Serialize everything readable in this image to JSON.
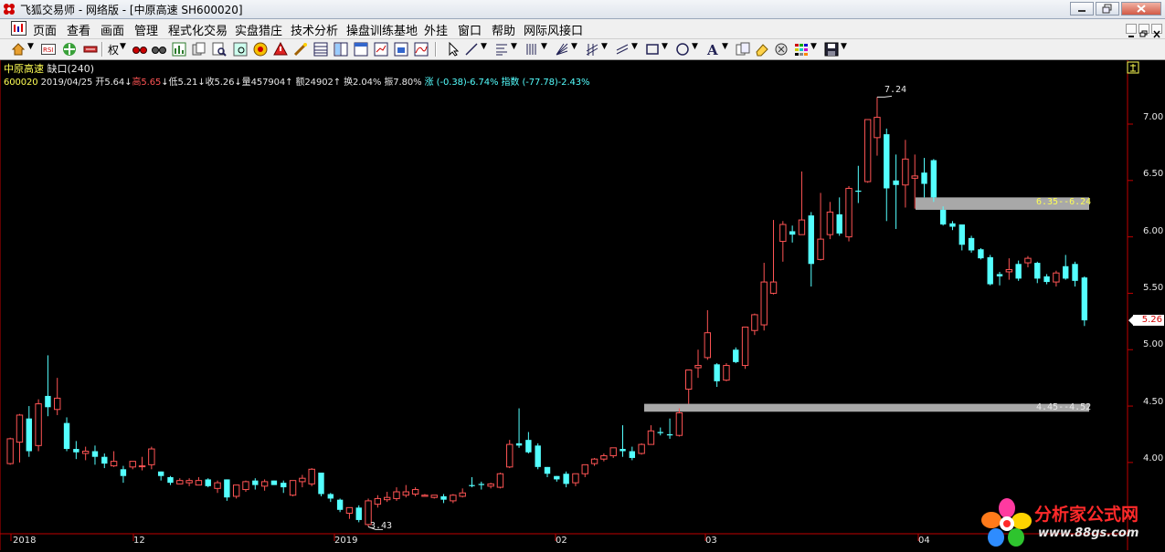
{
  "window": {
    "title": "飞狐交易师 - 网络版 - [中原高速 SH600020]"
  },
  "menu": {
    "items": [
      "页面",
      "查看",
      "画面",
      "管理",
      "程式化交易",
      "实盘猎庄",
      "技术分析",
      "操盘训练基地",
      "外挂",
      "窗口",
      "帮助",
      "网际风接口"
    ]
  },
  "toolbar": {
    "quan_label": "权",
    "icons": [
      "home-icon",
      "rsi-icon",
      "move-icon",
      "pan-icon",
      "glasses-icon",
      "binocular-icon",
      "stats-icon",
      "copy-icon",
      "find-icon",
      "target-icon",
      "alert-icon",
      "wand-icon",
      "grid-icon",
      "layout-icon",
      "window-icon",
      "chart-small-icon",
      "chart-line-icon",
      "pointer-icon",
      "line-tool-icon",
      "fibo-icon",
      "vlines-icon",
      "fan-icon",
      "channel-icon",
      "parallel-icon",
      "rect-icon",
      "circle-icon",
      "text-tool-icon",
      "copy-tool-icon",
      "eraser-icon",
      "settings-icon",
      "palette-icon",
      "save-icon"
    ]
  },
  "stock": {
    "name": "中原高速",
    "gap_label": "缺口",
    "period": "(240)",
    "code": "600020",
    "date": "2019/04/25",
    "open_label": "开",
    "open": "5.64",
    "open_arrow": "↓",
    "high_label": "高",
    "high": "5.65",
    "high_arrow": "↓",
    "low_label": "低",
    "low": "5.21",
    "low_arrow": "↓",
    "close_label": "收",
    "close": "5.26",
    "close_arrow": "↓",
    "volume_label": "量",
    "volume": "457904",
    "volume_arrow": "↑",
    "amount_label": "额",
    "amount": "24902",
    "amount_arrow": "↑",
    "turnover_label": "换",
    "turnover": "2.04%",
    "amplitude_label": "振",
    "amplitude": "7.80%",
    "change_label": "涨",
    "change": "(-0.38)-6.74%",
    "index_label": "指数",
    "index_change": "(-77.78)-2.43%"
  },
  "chart_data": {
    "type": "candlestick",
    "title": "中原高速 缺口(240)",
    "ylim": [
      3.3,
      7.4
    ],
    "y_ticks": [
      "7.00",
      "6.50",
      "6.00",
      "5.50",
      "5.00",
      "4.50",
      "4.00"
    ],
    "x_ticks": [
      "2018",
      "12",
      "2019",
      "02",
      "03",
      "04"
    ],
    "last_price": "5.26",
    "annotations": {
      "max": "7.24",
      "min": "3.43"
    },
    "gaps": [
      {
        "label": "6.35--6.24",
        "low": 6.24,
        "high": 6.35
      },
      {
        "label": "4.45--4.52",
        "low": 4.45,
        "high": 4.52
      }
    ],
    "candles": [
      {
        "o": 3.99,
        "c": 4.21,
        "h": 4.22,
        "l": 3.98
      },
      {
        "o": 4.18,
        "c": 4.42,
        "h": 4.43,
        "l": 4.0
      },
      {
        "o": 4.39,
        "c": 4.1,
        "h": 4.5,
        "l": 4.05
      },
      {
        "o": 4.15,
        "c": 4.52,
        "h": 4.56,
        "l": 4.1
      },
      {
        "o": 4.59,
        "c": 4.49,
        "h": 4.95,
        "l": 4.41
      },
      {
        "o": 4.47,
        "c": 4.57,
        "h": 4.75,
        "l": 4.42
      },
      {
        "o": 4.35,
        "c": 4.12,
        "h": 4.4,
        "l": 4.1
      },
      {
        "o": 4.12,
        "c": 4.09,
        "h": 4.19,
        "l": 4.03
      },
      {
        "o": 4.08,
        "c": 4.1,
        "h": 4.14,
        "l": 4.02
      },
      {
        "o": 4.1,
        "c": 4.05,
        "h": 4.15,
        "l": 3.98
      },
      {
        "o": 4.05,
        "c": 3.99,
        "h": 4.08,
        "l": 3.95
      },
      {
        "o": 3.97,
        "c": 4.01,
        "h": 4.1,
        "l": 3.96
      },
      {
        "o": 3.94,
        "c": 3.88,
        "h": 3.97,
        "l": 3.82
      },
      {
        "o": 3.96,
        "c": 4.01,
        "h": 4.01,
        "l": 3.94
      },
      {
        "o": 3.97,
        "c": 3.97,
        "h": 4.05,
        "l": 3.93
      },
      {
        "o": 3.98,
        "c": 4.12,
        "h": 4.14,
        "l": 3.94
      },
      {
        "o": 3.92,
        "c": 3.88,
        "h": 3.92,
        "l": 3.84
      },
      {
        "o": 3.87,
        "c": 3.82,
        "h": 3.88,
        "l": 3.8
      },
      {
        "o": 3.81,
        "c": 3.84,
        "h": 3.86,
        "l": 3.81
      },
      {
        "o": 3.82,
        "c": 3.84,
        "h": 3.86,
        "l": 3.79
      },
      {
        "o": 3.8,
        "c": 3.84,
        "h": 3.87,
        "l": 3.8
      },
      {
        "o": 3.85,
        "c": 3.79,
        "h": 3.86,
        "l": 3.78
      },
      {
        "o": 3.77,
        "c": 3.82,
        "h": 3.84,
        "l": 3.73
      },
      {
        "o": 3.85,
        "c": 3.69,
        "h": 3.85,
        "l": 3.66
      },
      {
        "o": 3.7,
        "c": 3.8,
        "h": 3.8,
        "l": 3.68
      },
      {
        "o": 3.76,
        "c": 3.83,
        "h": 3.84,
        "l": 3.74
      },
      {
        "o": 3.84,
        "c": 3.8,
        "h": 3.86,
        "l": 3.76
      },
      {
        "o": 3.79,
        "c": 3.83,
        "h": 3.85,
        "l": 3.75
      },
      {
        "o": 3.84,
        "c": 3.8,
        "h": 3.84,
        "l": 3.8
      },
      {
        "o": 3.82,
        "c": 3.78,
        "h": 3.84,
        "l": 3.73
      },
      {
        "o": 3.71,
        "c": 3.84,
        "h": 3.84,
        "l": 3.7
      },
      {
        "o": 3.83,
        "c": 3.86,
        "h": 3.89,
        "l": 3.78
      },
      {
        "o": 3.81,
        "c": 3.94,
        "h": 3.95,
        "l": 3.79
      },
      {
        "o": 3.91,
        "c": 3.72,
        "h": 3.91,
        "l": 3.7
      },
      {
        "o": 3.72,
        "c": 3.68,
        "h": 3.73,
        "l": 3.65
      },
      {
        "o": 3.67,
        "c": 3.58,
        "h": 3.68,
        "l": 3.56
      },
      {
        "o": 3.55,
        "c": 3.6,
        "h": 3.6,
        "l": 3.5
      },
      {
        "o": 3.6,
        "c": 3.49,
        "h": 3.62,
        "l": 3.47
      },
      {
        "o": 3.45,
        "c": 3.66,
        "h": 3.68,
        "l": 3.43
      },
      {
        "o": 3.63,
        "c": 3.68,
        "h": 3.71,
        "l": 3.6
      },
      {
        "o": 3.67,
        "c": 3.69,
        "h": 3.74,
        "l": 3.65
      },
      {
        "o": 3.68,
        "c": 3.74,
        "h": 3.78,
        "l": 3.66
      },
      {
        "o": 3.71,
        "c": 3.74,
        "h": 3.8,
        "l": 3.69
      },
      {
        "o": 3.72,
        "c": 3.76,
        "h": 3.78,
        "l": 3.7
      },
      {
        "o": 3.7,
        "c": 3.71,
        "h": 3.72,
        "l": 3.7
      },
      {
        "o": 3.69,
        "c": 3.71,
        "h": 3.71,
        "l": 3.68
      },
      {
        "o": 3.7,
        "c": 3.67,
        "h": 3.72,
        "l": 3.64
      },
      {
        "o": 3.66,
        "c": 3.71,
        "h": 3.72,
        "l": 3.64
      },
      {
        "o": 3.7,
        "c": 3.73,
        "h": 3.77,
        "l": 3.69
      },
      {
        "o": 3.8,
        "c": 3.79,
        "h": 3.87,
        "l": 3.78
      },
      {
        "o": 3.81,
        "c": 3.8,
        "h": 3.83,
        "l": 3.76
      },
      {
        "o": 3.79,
        "c": 3.81,
        "h": 3.82,
        "l": 3.77
      },
      {
        "o": 3.78,
        "c": 3.9,
        "h": 3.91,
        "l": 3.77
      },
      {
        "o": 3.96,
        "c": 4.16,
        "h": 4.2,
        "l": 3.95
      },
      {
        "o": 4.17,
        "c": 4.15,
        "h": 4.48,
        "l": 4.13
      },
      {
        "o": 4.2,
        "c": 4.09,
        "h": 4.27,
        "l": 4.08
      },
      {
        "o": 4.15,
        "c": 3.96,
        "h": 4.17,
        "l": 3.94
      },
      {
        "o": 3.96,
        "c": 3.9,
        "h": 3.96,
        "l": 3.87
      },
      {
        "o": 3.88,
        "c": 3.85,
        "h": 3.88,
        "l": 3.83
      },
      {
        "o": 3.9,
        "c": 3.81,
        "h": 3.92,
        "l": 3.78
      },
      {
        "o": 3.82,
        "c": 3.9,
        "h": 3.9,
        "l": 3.79
      },
      {
        "o": 3.9,
        "c": 3.98,
        "h": 3.98,
        "l": 3.87
      },
      {
        "o": 3.99,
        "c": 4.03,
        "h": 4.04,
        "l": 3.97
      },
      {
        "o": 4.03,
        "c": 4.06,
        "h": 4.08,
        "l": 4.01
      },
      {
        "o": 4.06,
        "c": 4.13,
        "h": 4.13,
        "l": 4.04
      },
      {
        "o": 4.12,
        "c": 4.1,
        "h": 4.33,
        "l": 4.05
      },
      {
        "o": 4.1,
        "c": 4.04,
        "h": 4.14,
        "l": 4.02
      },
      {
        "o": 4.08,
        "c": 4.16,
        "h": 4.17,
        "l": 4.07
      },
      {
        "o": 4.16,
        "c": 4.28,
        "h": 4.33,
        "l": 4.16
      },
      {
        "o": 4.27,
        "c": 4.26,
        "h": 4.31,
        "l": 4.24
      },
      {
        "o": 4.25,
        "c": 4.24,
        "h": 4.39,
        "l": 4.21
      },
      {
        "o": 4.24,
        "c": 4.44,
        "h": 4.48,
        "l": 4.23
      },
      {
        "o": 4.65,
        "c": 4.82,
        "h": 4.82,
        "l": 4.52
      },
      {
        "o": 4.84,
        "c": 4.86,
        "h": 5.0,
        "l": 4.75
      },
      {
        "o": 4.93,
        "c": 5.15,
        "h": 5.35,
        "l": 4.91
      },
      {
        "o": 4.87,
        "c": 4.72,
        "h": 4.88,
        "l": 4.67
      },
      {
        "o": 4.73,
        "c": 4.86,
        "h": 4.88,
        "l": 4.72
      },
      {
        "o": 5.0,
        "c": 4.89,
        "h": 5.02,
        "l": 4.88
      },
      {
        "o": 4.86,
        "c": 5.2,
        "h": 5.2,
        "l": 4.83
      },
      {
        "o": 5.17,
        "c": 5.31,
        "h": 5.32,
        "l": 5.13
      },
      {
        "o": 5.22,
        "c": 5.6,
        "h": 5.77,
        "l": 5.17
      },
      {
        "o": 5.5,
        "c": 5.6,
        "h": 6.15,
        "l": 5.49
      },
      {
        "o": 5.96,
        "c": 6.11,
        "h": 6.14,
        "l": 5.78
      },
      {
        "o": 6.05,
        "c": 6.02,
        "h": 6.1,
        "l": 5.95
      },
      {
        "o": 6.02,
        "c": 6.15,
        "h": 6.58,
        "l": 6.02
      },
      {
        "o": 6.19,
        "c": 5.76,
        "h": 6.22,
        "l": 5.56
      },
      {
        "o": 5.8,
        "c": 5.98,
        "h": 6.39,
        "l": 5.79
      },
      {
        "o": 6.02,
        "c": 6.22,
        "h": 6.31,
        "l": 5.98
      },
      {
        "o": 6.2,
        "c": 6.03,
        "h": 6.35,
        "l": 6.01
      },
      {
        "o": 6.0,
        "c": 6.43,
        "h": 6.45,
        "l": 5.96
      },
      {
        "o": 6.41,
        "c": 6.4,
        "h": 6.63,
        "l": 6.3
      },
      {
        "o": 6.49,
        "c": 7.04,
        "h": 7.04,
        "l": 6.48
      },
      {
        "o": 6.88,
        "c": 7.06,
        "h": 7.24,
        "l": 6.72
      },
      {
        "o": 6.91,
        "c": 6.43,
        "h": 6.96,
        "l": 6.14
      },
      {
        "o": 6.5,
        "c": 6.46,
        "h": 6.73,
        "l": 6.07
      },
      {
        "o": 6.46,
        "c": 6.69,
        "h": 6.86,
        "l": 6.26
      },
      {
        "o": 6.52,
        "c": 6.54,
        "h": 6.73,
        "l": 6.25
      },
      {
        "o": 6.57,
        "c": 6.47,
        "h": 6.7,
        "l": 6.35
      },
      {
        "o": 6.68,
        "c": 6.35,
        "h": 6.69,
        "l": 6.31
      },
      {
        "o": 6.24,
        "c": 6.11,
        "h": 6.27,
        "l": 6.1
      },
      {
        "o": 6.12,
        "c": 6.09,
        "h": 6.14,
        "l": 6.06
      },
      {
        "o": 6.11,
        "c": 5.93,
        "h": 6.11,
        "l": 5.88
      },
      {
        "o": 5.99,
        "c": 5.88,
        "h": 6.01,
        "l": 5.86
      },
      {
        "o": 5.89,
        "c": 5.81,
        "h": 5.9,
        "l": 5.8
      },
      {
        "o": 5.82,
        "c": 5.58,
        "h": 5.84,
        "l": 5.57
      },
      {
        "o": 5.67,
        "c": 5.65,
        "h": 5.69,
        "l": 5.57
      },
      {
        "o": 5.69,
        "c": 5.71,
        "h": 5.81,
        "l": 5.62
      },
      {
        "o": 5.76,
        "c": 5.63,
        "h": 5.79,
        "l": 5.61
      },
      {
        "o": 5.77,
        "c": 5.81,
        "h": 5.83,
        "l": 5.73
      },
      {
        "o": 5.77,
        "c": 5.63,
        "h": 5.78,
        "l": 5.59
      },
      {
        "o": 5.65,
        "c": 5.6,
        "h": 5.67,
        "l": 5.58
      },
      {
        "o": 5.6,
        "c": 5.68,
        "h": 5.7,
        "l": 5.56
      },
      {
        "o": 5.74,
        "c": 5.63,
        "h": 5.84,
        "l": 5.62
      },
      {
        "o": 5.76,
        "c": 5.61,
        "h": 5.78,
        "l": 5.56
      },
      {
        "o": 5.64,
        "c": 5.26,
        "h": 5.65,
        "l": 5.21
      }
    ]
  },
  "logo": {
    "brand": "分析家公式网",
    "url": "www.88gs.com"
  },
  "colors": {
    "up": "#ff5454",
    "down": "#54ffff",
    "gap_band": "#a8a8a8",
    "axis": "#c00000",
    "background": "#000000"
  }
}
